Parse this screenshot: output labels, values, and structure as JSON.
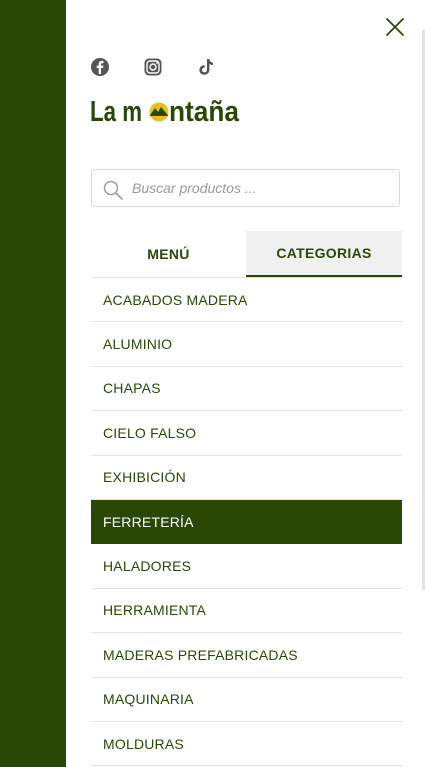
{
  "colors": {
    "brand_green": "#2b4706",
    "logo_yellow": "#e2c21a",
    "text_muted": "#9a9a9a"
  },
  "social": {
    "icons": [
      "facebook-icon",
      "instagram-icon",
      "tiktok-icon"
    ]
  },
  "logo": {
    "part1": "La m",
    "part2": "ntaña"
  },
  "search": {
    "placeholder": "Buscar productos ..."
  },
  "tabs": {
    "menu": "MENÚ",
    "categories": "CATEGORIAS",
    "active": "categories"
  },
  "categories": [
    {
      "label": "ACABADOS MADERA"
    },
    {
      "label": "ALUMINIO"
    },
    {
      "label": "CHAPAS"
    },
    {
      "label": "CIELO FALSO"
    },
    {
      "label": "EXHIBICIÓN"
    },
    {
      "label": "FERRETERÍA",
      "active": true
    },
    {
      "label": "HALADORES"
    },
    {
      "label": "HERRAMIENTA"
    },
    {
      "label": "MADERAS PREFABRICADAS"
    },
    {
      "label": "MAQUINARIA"
    },
    {
      "label": "MOLDURAS"
    }
  ]
}
